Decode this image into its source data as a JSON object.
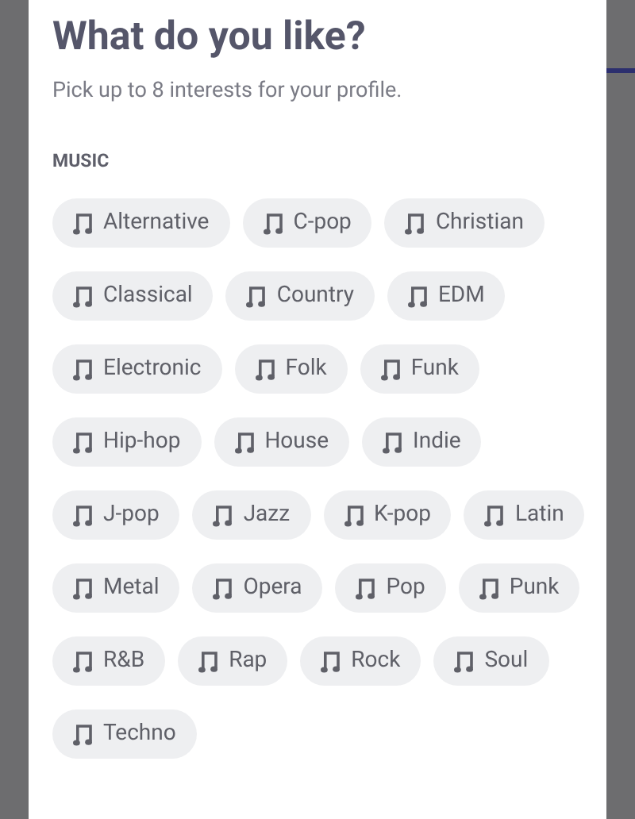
{
  "dialog": {
    "title": "What do you like?",
    "subtitle": "Pick up to 8 interests for your profile.",
    "section": {
      "heading": "MUSIC",
      "chips": [
        {
          "label": "Alternative",
          "selected": false
        },
        {
          "label": "C-pop",
          "selected": false
        },
        {
          "label": "Christian",
          "selected": false
        },
        {
          "label": "Classical",
          "selected": false
        },
        {
          "label": "Country",
          "selected": false
        },
        {
          "label": "EDM",
          "selected": false
        },
        {
          "label": "Electronic",
          "selected": false
        },
        {
          "label": "Folk",
          "selected": false
        },
        {
          "label": "Funk",
          "selected": false
        },
        {
          "label": "Hip-hop",
          "selected": false
        },
        {
          "label": "House",
          "selected": false
        },
        {
          "label": "Indie",
          "selected": false
        },
        {
          "label": "J-pop",
          "selected": false
        },
        {
          "label": "Jazz",
          "selected": false
        },
        {
          "label": "K-pop",
          "selected": false
        },
        {
          "label": "Latin",
          "selected": false
        },
        {
          "label": "Metal",
          "selected": false
        },
        {
          "label": "Opera",
          "selected": false
        },
        {
          "label": "Pop",
          "selected": false
        },
        {
          "label": "Punk",
          "selected": false
        },
        {
          "label": "R&B",
          "selected": false
        },
        {
          "label": "Rap",
          "selected": false
        },
        {
          "label": "Rock",
          "selected": false
        },
        {
          "label": "Soul",
          "selected": false
        },
        {
          "label": "Techno",
          "selected": false
        }
      ]
    }
  }
}
